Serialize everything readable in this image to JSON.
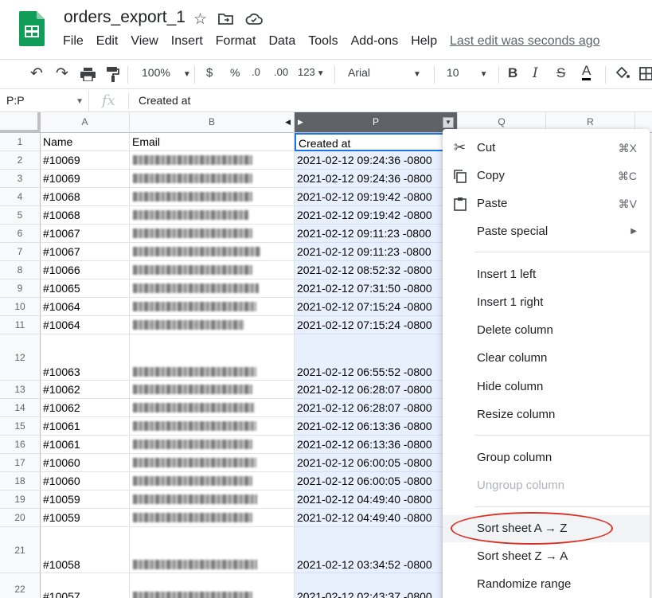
{
  "app": {
    "doc_title": "orders_export_1",
    "last_edit": "Last edit was seconds ago"
  },
  "menu": [
    "File",
    "Edit",
    "View",
    "Insert",
    "Format",
    "Data",
    "Tools",
    "Add-ons",
    "Help"
  ],
  "toolbar": {
    "zoom": "100%",
    "currency": "$",
    "percent": "%",
    "dec_less": ".0",
    "dec_more": ".00",
    "more_formats": "123",
    "font": "Arial",
    "font_size": "10"
  },
  "formula_bar": {
    "name_box": "P:P",
    "fx": "fx",
    "value": "Created at"
  },
  "columns": {
    "a": "A",
    "b": "B",
    "p": "P",
    "q": "Q",
    "r": "R"
  },
  "rows": [
    {
      "num": "1",
      "a": "Name",
      "b": "Email",
      "p": "Created at"
    },
    {
      "num": "2",
      "a": "#10069",
      "p": "2021-02-12 09:24:36 -0800"
    },
    {
      "num": "3",
      "a": "#10069",
      "p": "2021-02-12 09:24:36 -0800"
    },
    {
      "num": "4",
      "a": "#10068",
      "p": "2021-02-12 09:19:42 -0800"
    },
    {
      "num": "5",
      "a": "#10068",
      "p": "2021-02-12 09:19:42 -0800"
    },
    {
      "num": "6",
      "a": "#10067",
      "p": "2021-02-12 09:11:23 -0800"
    },
    {
      "num": "7",
      "a": "#10067",
      "p": "2021-02-12 09:11:23 -0800"
    },
    {
      "num": "8",
      "a": "#10066",
      "p": "2021-02-12 08:52:32 -0800"
    },
    {
      "num": "9",
      "a": "#10065",
      "p": "2021-02-12 07:31:50 -0800"
    },
    {
      "num": "10",
      "a": "#10064",
      "p": "2021-02-12 07:15:24 -0800"
    },
    {
      "num": "11",
      "a": "#10064",
      "p": "2021-02-12 07:15:24 -0800"
    },
    {
      "num": "12",
      "a": "#10063",
      "p": "2021-02-12 06:55:52 -0800"
    },
    {
      "num": "13",
      "a": "#10062",
      "p": "2021-02-12 06:28:07 -0800"
    },
    {
      "num": "14",
      "a": "#10062",
      "p": "2021-02-12 06:28:07 -0800"
    },
    {
      "num": "15",
      "a": "#10061",
      "p": "2021-02-12 06:13:36 -0800"
    },
    {
      "num": "16",
      "a": "#10061",
      "p": "2021-02-12 06:13:36 -0800"
    },
    {
      "num": "17",
      "a": "#10060",
      "p": "2021-02-12 06:00:05 -0800"
    },
    {
      "num": "18",
      "a": "#10060",
      "p": "2021-02-12 06:00:05 -0800"
    },
    {
      "num": "19",
      "a": "#10059",
      "p": "2021-02-12 04:49:40 -0800"
    },
    {
      "num": "20",
      "a": "#10059",
      "p": "2021-02-12 04:49:40 -0800"
    },
    {
      "num": "21",
      "a": "#10058",
      "p": "2021-02-12 03:34:52 -0800"
    },
    {
      "num": "22",
      "a": "#10057",
      "p": "2021-02-12 02:43:37 -0800"
    }
  ],
  "context_menu": {
    "cut": "Cut",
    "cut_sc": "⌘X",
    "copy": "Copy",
    "copy_sc": "⌘C",
    "paste": "Paste",
    "paste_sc": "⌘V",
    "paste_special": "Paste special",
    "insert_left": "Insert 1 left",
    "insert_right": "Insert 1 right",
    "delete_column": "Delete column",
    "clear_column": "Clear column",
    "hide_column": "Hide column",
    "resize_column": "Resize column",
    "group_column": "Group column",
    "ungroup_column": "Ungroup column",
    "sort_az": "Sort sheet A → Z",
    "sort_za": "Sort sheet Z → A",
    "randomize": "Randomize range"
  },
  "colors": {
    "accent": "#1a73e8",
    "selected_col_header": "#5f6368",
    "selected_fill": "#e8f0fe",
    "highlight_oval": "#d93025",
    "sheets_green": "#0f9d58"
  }
}
